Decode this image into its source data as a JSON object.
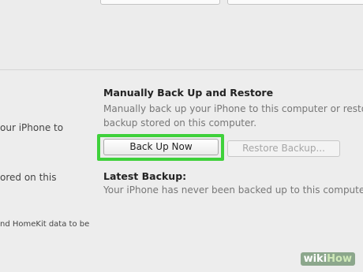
{
  "left_panel": {
    "line1": "our iPhone to",
    "line2": "ored on this",
    "line3": "nd HomeKit data to be"
  },
  "manual": {
    "title": "Manually Back Up and Restore",
    "desc_line1": "Manually back up your iPhone to this computer or restore",
    "desc_line2": "backup stored on this computer.",
    "back_up_now": "Back Up Now",
    "restore_backup": "Restore Backup..."
  },
  "latest": {
    "title": "Latest Backup:",
    "desc": "Your iPhone has never been backed up to this computer."
  },
  "watermark": {
    "wiki": "wiki",
    "how": "How"
  },
  "colors": {
    "highlight": "#3fd13b",
    "background": "#ededed"
  }
}
